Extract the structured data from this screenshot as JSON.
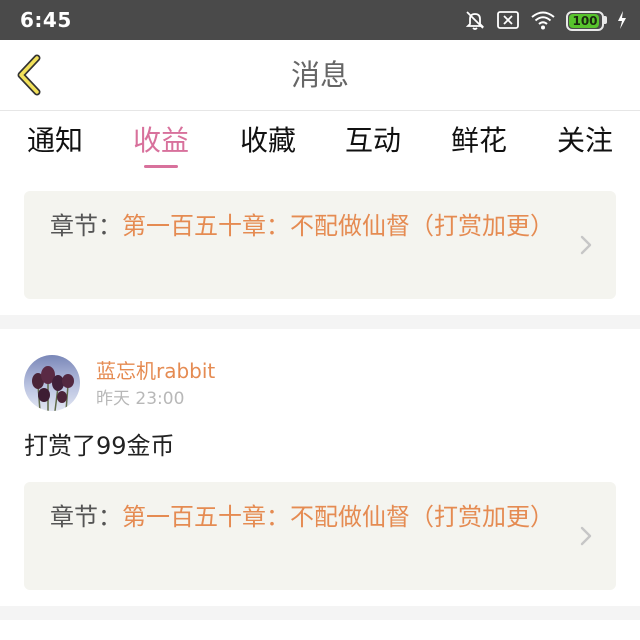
{
  "status_bar": {
    "time": "6:45",
    "battery_level": "100",
    "battery_fraction": 1.0,
    "icons": [
      "mute-bell-icon",
      "notification-off-icon",
      "wifi-icon",
      "battery-icon",
      "charging-icon"
    ]
  },
  "header": {
    "title": "消息",
    "back_icon": "chevron-left-icon"
  },
  "tabs": [
    {
      "label": "通知",
      "active": false
    },
    {
      "label": "收益",
      "active": true
    },
    {
      "label": "收藏",
      "active": false
    },
    {
      "label": "互动",
      "active": false
    },
    {
      "label": "鲜花",
      "active": false
    },
    {
      "label": "关注",
      "active": false
    }
  ],
  "colors": {
    "accent_pink": "#d8719c",
    "accent_orange": "#e58b52",
    "status_bar": "#4a4a4a",
    "card_bg": "#f4f4ef"
  },
  "items": [
    {
      "chapter_label": "章节：",
      "chapter_title": "第一百五十章：不配做仙督（打赏加更）"
    },
    {
      "username": "蓝忘机rabbit",
      "time": "昨天 23:00",
      "action": "打赏了99金币",
      "chapter_label": "章节：",
      "chapter_title": "第一百五十章：不配做仙督（打赏加更）"
    }
  ]
}
